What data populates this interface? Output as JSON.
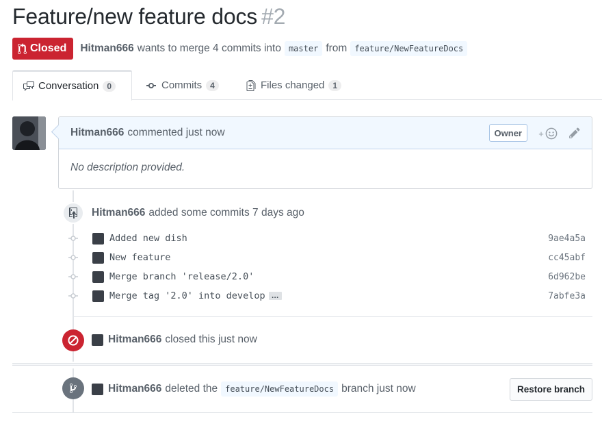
{
  "pr": {
    "title": "Feature/new feature docs",
    "number": "#2",
    "state_label": "Closed",
    "author": "Hitman666",
    "merge_text": "wants to merge 4 commits into",
    "base_branch": "master",
    "from_text": "from",
    "head_branch": "feature/NewFeatureDocs"
  },
  "tabs": [
    {
      "label": "Conversation",
      "count": "0",
      "icon": "comment-discussion-icon"
    },
    {
      "label": "Commits",
      "count": "4",
      "icon": "git-commit-icon"
    },
    {
      "label": "Files changed",
      "count": "1",
      "icon": "file-diff-icon"
    }
  ],
  "comment": {
    "author": "Hitman666",
    "action": "commented just now",
    "owner_label": "Owner",
    "react_symbol": "+",
    "body": "No description provided."
  },
  "commits_event": {
    "author": "Hitman666",
    "text": "added some commits 7 days ago",
    "commits": [
      {
        "message": "Added new dish",
        "sha": "9ae4a5a"
      },
      {
        "message": "New feature",
        "sha": "cc45abf"
      },
      {
        "message": "Merge branch 'release/2.0'",
        "sha": "6d962be"
      },
      {
        "message": "Merge tag '2.0' into develop",
        "sha": "7abfe3a",
        "expand": "…"
      }
    ]
  },
  "closed_event": {
    "author": "Hitman666",
    "text": "closed this just now"
  },
  "deleted_event": {
    "author": "Hitman666",
    "text_before": "deleted the",
    "branch": "feature/NewFeatureDocs",
    "text_after": "branch just now",
    "restore_label": "Restore branch"
  },
  "colors": {
    "closed_red": "#cb2431",
    "muted_text": "#586069",
    "header_blue": "#f1f8ff"
  }
}
